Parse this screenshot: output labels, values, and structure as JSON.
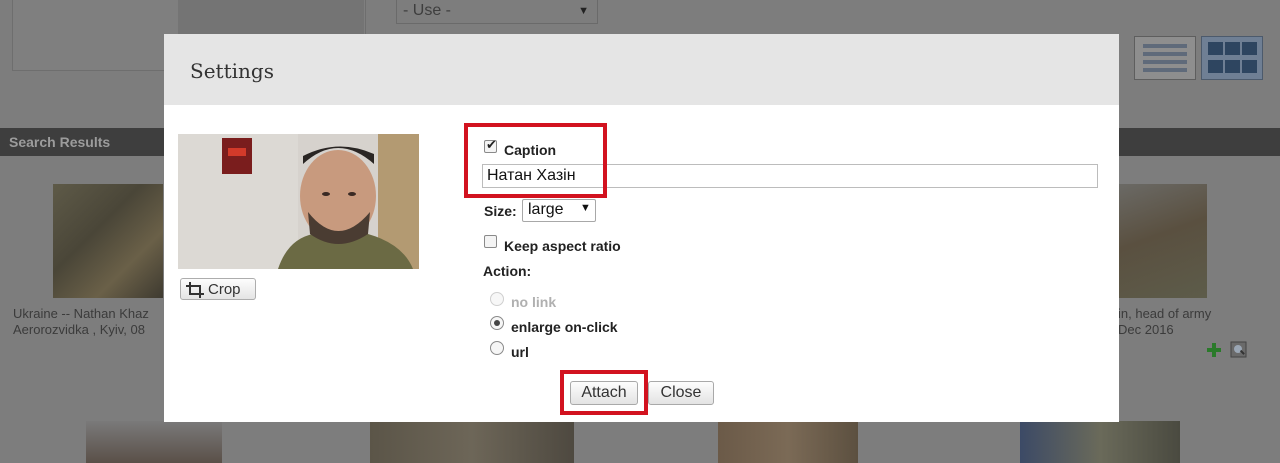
{
  "background": {
    "use_select_value": "- Use -",
    "search_results_label": "Search Results",
    "result_left_text": "Ukraine -- Nathan Khaz\nAerorozvidka , Kyiv, 08",
    "result_right_text": "in, head of army\nDec 2016"
  },
  "dialog": {
    "title": "Settings",
    "crop_label": "Crop",
    "caption_label": "Caption",
    "caption_checked": true,
    "caption_value": "Натан Хазін",
    "size_label": "Size:",
    "size_value": "large",
    "keep_aspect_label": "Keep aspect ratio",
    "keep_aspect_checked": false,
    "action_label": "Action:",
    "actions": [
      {
        "label": "no link",
        "selected": false,
        "disabled": true
      },
      {
        "label": "enlarge on-click",
        "selected": true,
        "disabled": false
      },
      {
        "label": "url",
        "selected": false,
        "disabled": false
      }
    ],
    "attach_label": "Attach",
    "close_label": "Close"
  },
  "colors": {
    "highlight": "#d2121f",
    "header_bg": "#e5e5e5",
    "overlay": "#7d7d7d"
  }
}
